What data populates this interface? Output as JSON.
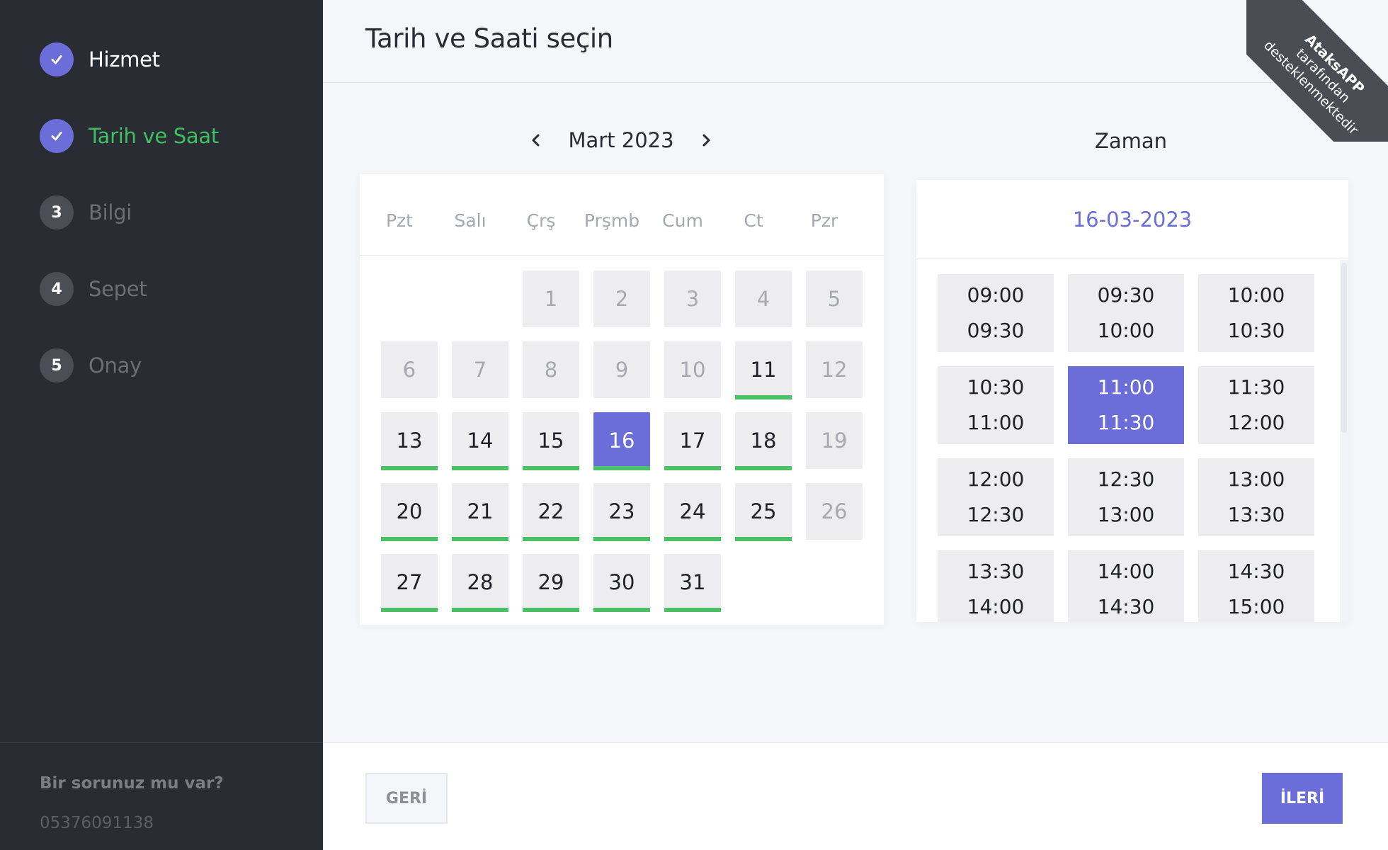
{
  "sidebar": {
    "steps": [
      {
        "number": "",
        "label": "Hizmet",
        "state": "done"
      },
      {
        "number": "",
        "label": "Tarih ve Saat",
        "state": "active"
      },
      {
        "number": "3",
        "label": "Bilgi",
        "state": "todo"
      },
      {
        "number": "4",
        "label": "Sepet",
        "state": "todo"
      },
      {
        "number": "5",
        "label": "Onay",
        "state": "todo"
      }
    ],
    "help_text": "Bir sorunuz mu var?",
    "help_phone": "05376091138"
  },
  "header": {
    "title": "Tarih ve Saati seçin"
  },
  "ribbon": {
    "brand": "AtaksAPP",
    "line2": "tarafından",
    "line3": "desteklenmektedir"
  },
  "calendar": {
    "month_label": "Mart 2023",
    "prev_icon": "chevron-left-icon",
    "next_icon": "chevron-right-icon",
    "weekdays": [
      "Pzt",
      "Salı",
      "Çrş",
      "Prşmb",
      "Cum",
      "Ct",
      "Pzr"
    ],
    "days": [
      {
        "day": "1",
        "state": "past"
      },
      {
        "day": "2",
        "state": "past"
      },
      {
        "day": "3",
        "state": "past"
      },
      {
        "day": "4",
        "state": "past"
      },
      {
        "day": "5",
        "state": "past"
      },
      {
        "day": "6",
        "state": "past"
      },
      {
        "day": "7",
        "state": "past"
      },
      {
        "day": "8",
        "state": "past"
      },
      {
        "day": "9",
        "state": "past"
      },
      {
        "day": "10",
        "state": "past"
      },
      {
        "day": "11",
        "state": "available"
      },
      {
        "day": "12",
        "state": "past"
      },
      {
        "day": "13",
        "state": "available"
      },
      {
        "day": "14",
        "state": "available"
      },
      {
        "day": "15",
        "state": "available"
      },
      {
        "day": "16",
        "state": "selected"
      },
      {
        "day": "17",
        "state": "available"
      },
      {
        "day": "18",
        "state": "available"
      },
      {
        "day": "19",
        "state": "past"
      },
      {
        "day": "20",
        "state": "available"
      },
      {
        "day": "21",
        "state": "available"
      },
      {
        "day": "22",
        "state": "available"
      },
      {
        "day": "23",
        "state": "available"
      },
      {
        "day": "24",
        "state": "available"
      },
      {
        "day": "25",
        "state": "available"
      },
      {
        "day": "26",
        "state": "past"
      },
      {
        "day": "27",
        "state": "available"
      },
      {
        "day": "28",
        "state": "available"
      },
      {
        "day": "29",
        "state": "available"
      },
      {
        "day": "30",
        "state": "available"
      },
      {
        "day": "31",
        "state": "available"
      }
    ]
  },
  "time": {
    "title": "Zaman",
    "selected_date": "16-03-2023",
    "slots": [
      {
        "start": "09:00",
        "end": "09:30",
        "selected": false
      },
      {
        "start": "09:30",
        "end": "10:00",
        "selected": false
      },
      {
        "start": "10:00",
        "end": "10:30",
        "selected": false
      },
      {
        "start": "10:30",
        "end": "11:00",
        "selected": false
      },
      {
        "start": "11:00",
        "end": "11:30",
        "selected": true
      },
      {
        "start": "11:30",
        "end": "12:00",
        "selected": false
      },
      {
        "start": "12:00",
        "end": "12:30",
        "selected": false
      },
      {
        "start": "12:30",
        "end": "13:00",
        "selected": false
      },
      {
        "start": "13:00",
        "end": "13:30",
        "selected": false
      },
      {
        "start": "13:30",
        "end": "14:00",
        "selected": false
      },
      {
        "start": "14:00",
        "end": "14:30",
        "selected": false
      },
      {
        "start": "14:30",
        "end": "15:00",
        "selected": false
      }
    ]
  },
  "footer": {
    "back_label": "GERİ",
    "next_label": "İLERİ"
  },
  "colors": {
    "accent": "#6b6ed9",
    "available": "#4cc066",
    "sidebar_bg": "#292c33"
  }
}
